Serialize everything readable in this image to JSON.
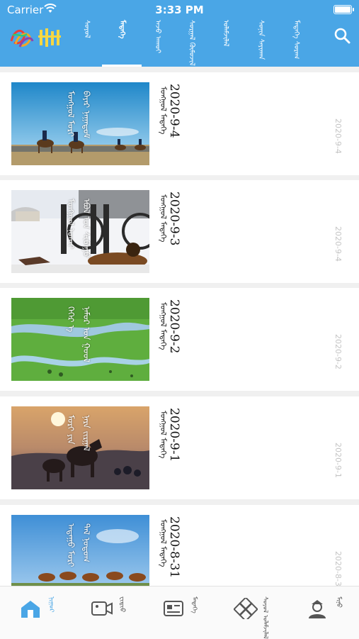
{
  "status_bar": {
    "carrier": "Carrier",
    "time": "3:33 PM"
  },
  "header": {
    "logo_text": "ᠮᠣᠩᠭᠣᠯ",
    "tabs": [
      {
        "label": "ᠰᠣᠶᠣᠯ",
        "active": false
      },
      {
        "label": "ᠮᠡᠳᠡᠭᠡ",
        "active": true
      },
      {
        "label": "ᠠᠵᠤ ᠠᠬᠤᠢ",
        "active": false
      },
      {
        "label": "ᠰᠤᠷᠭᠠᠯ ᠬᠦᠮᠦᠵᠢᠯ",
        "active": false
      },
      {
        "label": "ᠤᠯᠠᠮᠵᠢᠯᠠᠯ",
        "active": false
      },
      {
        "label": "ᠰᠣᠨᠢᠨ ᠰᠠᠶᠢᠬᠠᠨ",
        "active": false
      },
      {
        "label": "ᠮᠡᠳᠡᠭᠡ ᠰᠤᠷᠠᠭ",
        "active": false
      }
    ]
  },
  "articles": [
    {
      "title": "2020-9-4",
      "subtitle": "ᠮᠣᠩᠭᠣᠯ ᠮᠡᠳᠡᠭᠡ",
      "date": "2020-9-4",
      "caption": "ᠮᠣᠩᠭᠣᠯ ᠮᠣᠷᠢ",
      "caption2": "ᠪᠠᠶᠠᠷ ᠨᠠᠭᠠᠳᠤᠮ",
      "scene": "horse-race"
    },
    {
      "title": "2020-9-3",
      "subtitle": "ᠮᠣᠩᠭᠣᠯ ᠮᠡᠳᠡᠭᠡ",
      "date": "2020-9-4",
      "caption": "ᠮᠣᠩᠭᠣᠯ ᠨᠣᠬᠠᠢ",
      "caption2": "ᠡᠪᠦᠯ ᠤᠨ ᠰᠢᠪᠠᠭᠤ",
      "scene": "winter-dog"
    },
    {
      "title": "2020-9-2",
      "subtitle": "ᠮᠣᠩᠭᠣᠯ ᠮᠡᠳᠡᠭᠡ",
      "date": "2020-9-2",
      "caption": "ᠬᠡᠭᠡᠷ ᠡ",
      "caption2": "ᠨᠠᠮᠤᠷ ᠤᠨ ᠭᠣᠣᠯ",
      "scene": "grassland"
    },
    {
      "title": "2020-9-1",
      "subtitle": "ᠮᠣᠩᠭᠣᠯ ᠮᠡᠳᠡᠭᠡ",
      "date": "2020-9-1",
      "caption": "ᠮᠣᠷᠢ ᠶᠢᠨ",
      "caption2": "ᠨᠠᠷᠠ ᠵᠢᠷᠭᠠᠯ",
      "scene": "sunset"
    },
    {
      "title": "2020-8-31",
      "subtitle": "ᠮᠣᠩᠭᠣᠯ ᠮᠡᠳᠡᠭᠡ",
      "date": "2020-8-31",
      "caption": "ᠠᠳᠠᠭᠤ ᠮᠣᠷᠢ",
      "caption2": "ᠲᠠᠯ ᠨᠤᠲᠤᠭ",
      "scene": "herd"
    }
  ],
  "tabbar": [
    {
      "label": "ᠨᠢᠭᠤᠷ",
      "icon": "home-icon",
      "active": true
    },
    {
      "label": "ᠸᠢᠳᠢᠤ",
      "icon": "video-icon",
      "active": false
    },
    {
      "label": "ᠮᠡᠳᠡᠭᠡ",
      "icon": "news-card-icon",
      "active": false
    },
    {
      "label": "ᠰᠣᠶᠣᠯ ᠤᠯᠠᠮᠵᠢᠯᠠᠯ",
      "icon": "knot-icon",
      "active": false
    },
    {
      "label": "ᠮᠢᠨᠤ",
      "icon": "user-icon",
      "active": false
    }
  ],
  "colors": {
    "header": "#4aa6e6",
    "accent": "#4aa6e6",
    "date": "#c4c4c4"
  }
}
